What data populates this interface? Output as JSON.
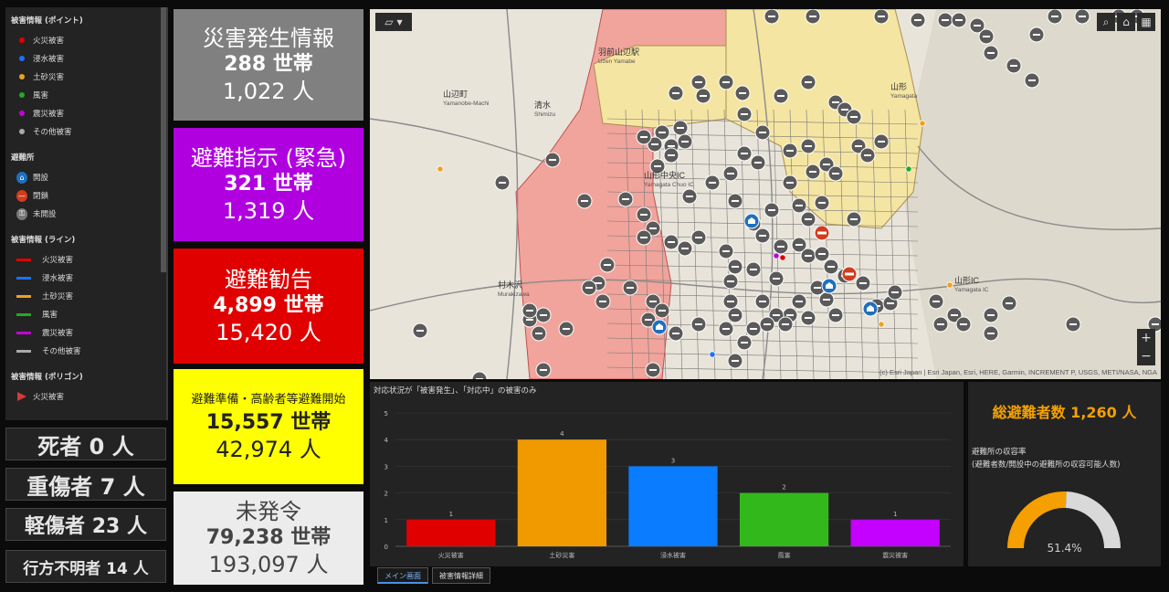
{
  "legend": {
    "point_title": "被害情報 (ポイント)",
    "points": [
      {
        "label": "火災被害",
        "color": "#e00000"
      },
      {
        "label": "浸水被害",
        "color": "#1f6fff"
      },
      {
        "label": "土砂災害",
        "color": "#f0a020"
      },
      {
        "label": "風害",
        "color": "#22aa22"
      },
      {
        "label": "震災被害",
        "color": "#c400d8"
      },
      {
        "label": "その他被害",
        "color": "#aaaaaa"
      }
    ],
    "shelter_title": "避難所",
    "shelters": [
      {
        "label": "開設",
        "icon": "shelter-open-icon",
        "color": "#1f6fbf"
      },
      {
        "label": "閉鎖",
        "icon": "shelter-closed-icon",
        "color": "#d23c1e"
      },
      {
        "label": "未開設",
        "icon": "shelter-unopened-icon",
        "color": "#777777"
      }
    ],
    "line_title": "被害情報 (ライン)",
    "lines": [
      {
        "label": "火災被害",
        "color": "#e00000"
      },
      {
        "label": "浸水被害",
        "color": "#1f6fff"
      },
      {
        "label": "土砂災害",
        "color": "#f0a020"
      },
      {
        "label": "風害",
        "color": "#22aa22"
      },
      {
        "label": "震災被害",
        "color": "#c400d8"
      },
      {
        "label": "その他被害",
        "color": "#aaaaaa"
      }
    ],
    "polygon_title": "被害情報 (ポリゴン)",
    "polygons": [
      {
        "label": "火災被害",
        "color": "#d63a3a"
      }
    ]
  },
  "casualties": {
    "dead": "死者 0 人",
    "serious": "重傷者 7 人",
    "minor": "軽傷者 23 人",
    "missing": "行方不明者 14 人"
  },
  "cards": [
    {
      "title": "災害発生情報",
      "households": "288 世帯",
      "people": "1,022 人",
      "bg": "#808080",
      "fg": "#ffffff"
    },
    {
      "title": "避難指示 (緊急)",
      "households": "321 世帯",
      "people": "1,319 人",
      "bg": "#b000e0",
      "fg": "#ffffff"
    },
    {
      "title": "避難勧告",
      "households": "4,899 世帯",
      "people": "15,420 人",
      "bg": "#e00000",
      "fg": "#ffffff"
    },
    {
      "title": "避難準備・高齢者等避難開始",
      "households": "15,557 世帯",
      "people": "42,974 人",
      "bg": "#ffff00",
      "fg": "#222222"
    },
    {
      "title": "未発令",
      "households": "79,238 世帯",
      "people": "193,097 人",
      "bg": "#ececec",
      "fg": "#444444"
    }
  ],
  "map": {
    "attribution": "(c) Esri Japan | Esri Japan, Esri, HERE, Garmin, INCREMENT P, USGS, METI/NASA, NGA",
    "labels": [
      {
        "text": "山辺町",
        "sub": "Yamanobe-Machi"
      },
      {
        "text": "清水",
        "sub": "Shimizu"
      },
      {
        "text": "羽前山辺駅",
        "sub": "Uzen Yamabe"
      },
      {
        "text": "村木沢",
        "sub": "Murakizawa"
      },
      {
        "text": "山形中央IC",
        "sub": "Yamagata Chuo IC"
      },
      {
        "text": "山形IC",
        "sub": "Yamagata IC"
      },
      {
        "text": "山形",
        "sub": "Yamagata"
      }
    ]
  },
  "chart_data": {
    "type": "bar",
    "title": "対応状況が「被害発生」、「対応中」の被害のみ",
    "categories": [
      "火災被害",
      "土砂災害",
      "浸水被害",
      "風害",
      "震災被害"
    ],
    "values": [
      1,
      4,
      3,
      2,
      1
    ],
    "colors": [
      "#e00000",
      "#f09a00",
      "#0a7cff",
      "#33b81c",
      "#c400ff"
    ],
    "ylim": [
      0,
      5
    ],
    "yticks": [
      0,
      1,
      2,
      3,
      4,
      5
    ]
  },
  "evac": {
    "title": "総避難者数 1,260 人",
    "label1": "避難所の収容率",
    "label2": "(避難者数/開設中の避難所の収容可能人数)",
    "rate": "51.4%",
    "rate_value": 51.4,
    "color": "#f5a000"
  },
  "tabs": [
    "メイン画面",
    "被害情報詳細"
  ]
}
